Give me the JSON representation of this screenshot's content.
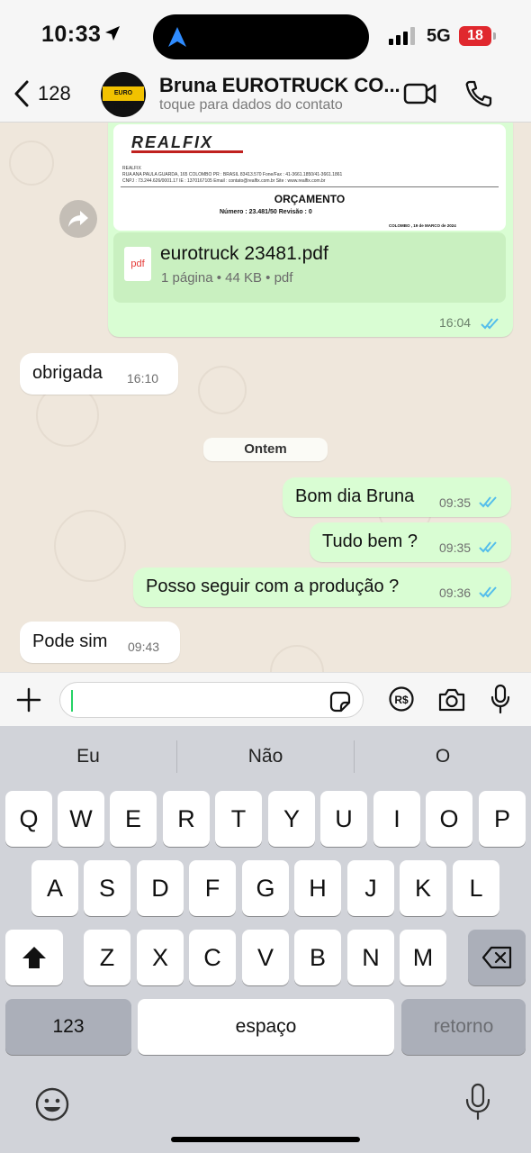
{
  "status": {
    "time": "10:33",
    "network": "5G",
    "battery": "18"
  },
  "header": {
    "back_count": "128",
    "contact_name": "Bruna EUROTRUCK CO...",
    "contact_sub": "toque para dados do contato",
    "avatar_logo": "EURO TRUCK"
  },
  "messages": {
    "pdf": {
      "preview_brand": "REALFIX",
      "preview_line1": "REALFIX",
      "preview_line2": "RUA ANA PAULA GUARDA, 165                         COLOMBO              PR : BRASIL               83413.570              Fone/Fax :     41-3661.1850/41-3661.1861",
      "preview_line3": "CNPJ :   73.244.626/0001.17        IE :    1370167105                    Email :   contato@realfix.com.br                   Site :     www.realfix.com.br",
      "preview_title": "ORÇAMENTO",
      "preview_number": "Número :        23.481/50                Revisão :       0",
      "preview_date": "COLOMBO          , 19 de MARCO     de 2024",
      "file_icon": "pdf",
      "file_name": "eurotruck 23481.pdf",
      "file_meta": "1 página • 44 KB • pdf",
      "time": "16:04"
    },
    "obrigada": {
      "text": "obrigada",
      "time": "16:10"
    },
    "date_separator": "Ontem",
    "bom_dia": {
      "text": "Bom dia Bruna",
      "time": "09:35"
    },
    "tudo_bem": {
      "text": "Tudo bem ?",
      "time": "09:35"
    },
    "posso": {
      "text": "Posso seguir com a produção ?",
      "time": "09:36"
    },
    "pode_sim": {
      "text": "Pode sim",
      "time": "09:43"
    }
  },
  "input": {
    "placeholder": ""
  },
  "keyboard": {
    "suggestions": [
      "Eu",
      "Não",
      "O"
    ],
    "row1": [
      "Q",
      "W",
      "E",
      "R",
      "T",
      "Y",
      "U",
      "I",
      "O",
      "P"
    ],
    "row2": [
      "A",
      "S",
      "D",
      "F",
      "G",
      "H",
      "J",
      "K",
      "L"
    ],
    "row3": [
      "Z",
      "X",
      "C",
      "V",
      "B",
      "N",
      "M"
    ],
    "numbers": "123",
    "space": "espaço",
    "return": "retorno"
  },
  "colors": {
    "outgoing": "#d9fdd3",
    "incoming": "#ffffff",
    "read_ticks": "#53bdeb",
    "chat_bg": "#efe7dc"
  }
}
